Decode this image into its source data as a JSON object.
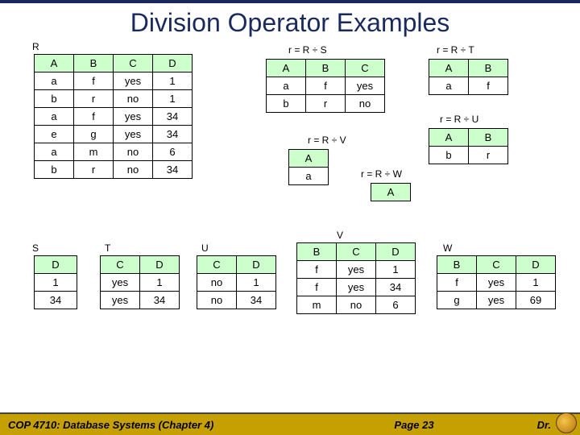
{
  "title": "Division Operator Examples",
  "labels": {
    "R": "R",
    "S": "S",
    "T": "T",
    "U": "U",
    "V": "V",
    "W": "W"
  },
  "eq": {
    "RS": "r = R ÷ S",
    "RT": "r = R ÷ T",
    "RU": "r = R ÷ U",
    "RV": "r = R ÷ V",
    "RW": "r = R ÷ W"
  },
  "R": {
    "h": [
      "A",
      "B",
      "C",
      "D"
    ],
    "rows": [
      [
        "a",
        "f",
        "yes",
        "1"
      ],
      [
        "b",
        "r",
        "no",
        "1"
      ],
      [
        "a",
        "f",
        "yes",
        "34"
      ],
      [
        "e",
        "g",
        "yes",
        "34"
      ],
      [
        "a",
        "m",
        "no",
        "6"
      ],
      [
        "b",
        "r",
        "no",
        "34"
      ]
    ]
  },
  "RS": {
    "h": [
      "A",
      "B",
      "C"
    ],
    "rows": [
      [
        "a",
        "f",
        "yes"
      ],
      [
        "b",
        "r",
        "no"
      ]
    ]
  },
  "RT": {
    "h": [
      "A",
      "B"
    ],
    "rows": [
      [
        "a",
        "f"
      ]
    ]
  },
  "RU": {
    "h": [
      "A",
      "B"
    ],
    "rows": [
      [
        "b",
        "r"
      ]
    ]
  },
  "RV": {
    "h": [
      "A"
    ],
    "rows": [
      [
        "a"
      ]
    ]
  },
  "RW": {
    "h": [
      "A"
    ],
    "rows": []
  },
  "S": {
    "h": [
      "D"
    ],
    "rows": [
      [
        "1"
      ],
      [
        "34"
      ]
    ]
  },
  "T": {
    "h": [
      "C",
      "D"
    ],
    "rows": [
      [
        "yes",
        "1"
      ],
      [
        "yes",
        "34"
      ]
    ]
  },
  "U": {
    "h": [
      "C",
      "D"
    ],
    "rows": [
      [
        "no",
        "1"
      ],
      [
        "no",
        "34"
      ]
    ]
  },
  "V": {
    "h": [
      "B",
      "C",
      "D"
    ],
    "rows": [
      [
        "f",
        "yes",
        "1"
      ],
      [
        "f",
        "yes",
        "34"
      ],
      [
        "m",
        "no",
        "6"
      ]
    ]
  },
  "W": {
    "h": [
      "B",
      "C",
      "D"
    ],
    "rows": [
      [
        "f",
        "yes",
        "1"
      ],
      [
        "g",
        "yes",
        "69"
      ]
    ]
  },
  "footer": {
    "course": "COP 4710: Database Systems  (Chapter 4)",
    "page": "Page 23",
    "author": "Dr."
  }
}
